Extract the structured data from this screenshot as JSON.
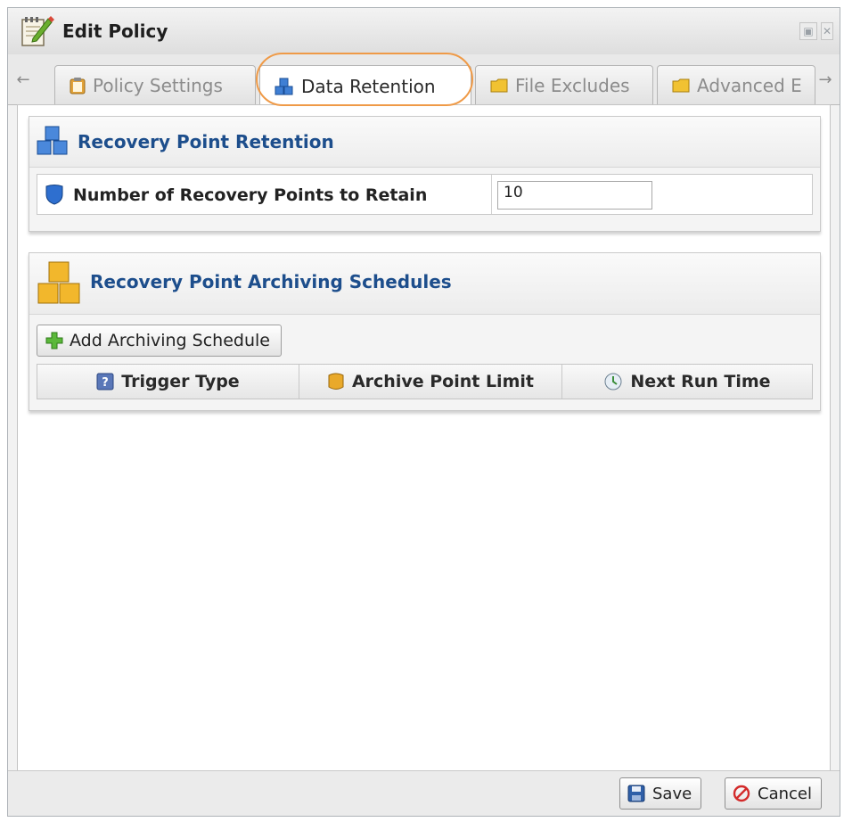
{
  "window": {
    "title": "Edit Policy",
    "restore_label": "▣",
    "close_label": "✕"
  },
  "tabs": {
    "scroll_left": "←",
    "scroll_right": "→",
    "items": [
      {
        "label": "Policy Settings",
        "icon": "clipboard-icon",
        "active": false
      },
      {
        "label": "Data Retention",
        "icon": "cubes-icon",
        "active": true
      },
      {
        "label": "File Excludes",
        "icon": "folder-icon",
        "active": false
      },
      {
        "label": "Advanced E",
        "icon": "folder-icon",
        "active": false
      }
    ]
  },
  "retention": {
    "title": "Recovery Point Retention",
    "field_label": "Number of Recovery Points to Retain",
    "field_value": "10"
  },
  "archiving": {
    "title": "Recovery Point Archiving Schedules",
    "add_button": "Add Archiving Schedule",
    "columns": [
      {
        "label": "Trigger Type",
        "icon": "help-icon"
      },
      {
        "label": "Archive Point Limit",
        "icon": "cylinder-icon"
      },
      {
        "label": "Next Run Time",
        "icon": "clock-icon"
      }
    ]
  },
  "footer": {
    "save_label": "Save",
    "cancel_label": "Cancel"
  },
  "colors": {
    "accent_ring": "#ef9a47",
    "panel_title": "#1d4e8c"
  }
}
